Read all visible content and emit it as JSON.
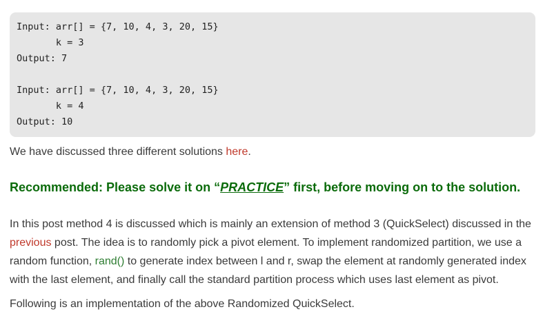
{
  "code_block": {
    "lines": [
      "Input: arr[] = {7, 10, 4, 3, 20, 15}",
      "       k = 3",
      "Output: 7",
      "",
      "Input: arr[] = {7, 10, 4, 3, 20, 15}",
      "       k = 4",
      "Output: 10"
    ]
  },
  "discussed": {
    "text_before": "We have discussed three different solutions ",
    "link": "here",
    "text_after": "."
  },
  "recommended": {
    "prefix": "Recommended: Please solve it on “",
    "link": "PRACTICE",
    "suffix": "” first, before moving on to the solution."
  },
  "method_paragraph": {
    "line1": "In this post method 4 is discussed which is mainly an extension of method 3 (QuickSelect) discussed in the",
    "line2_link": "previous",
    "line2_rest": " post. The idea is to randomly pick a pivot element. To implement randomized partition, we use a",
    "line3_before": "random function, ",
    "line3_link": "rand()",
    "line3_after": " to generate index between l and r, swap the element at randomly generated index",
    "line4": "with the last element, and finally call the standard partition process which uses last element as pivot."
  },
  "following": {
    "text": "Following is an implementation of the above Randomized QuickSelect."
  },
  "colors": {
    "code_bg": "#e6e6e6",
    "link_red": "#c0392b",
    "heading_green": "#0b6b0b",
    "func_green": "#2e7d32"
  }
}
